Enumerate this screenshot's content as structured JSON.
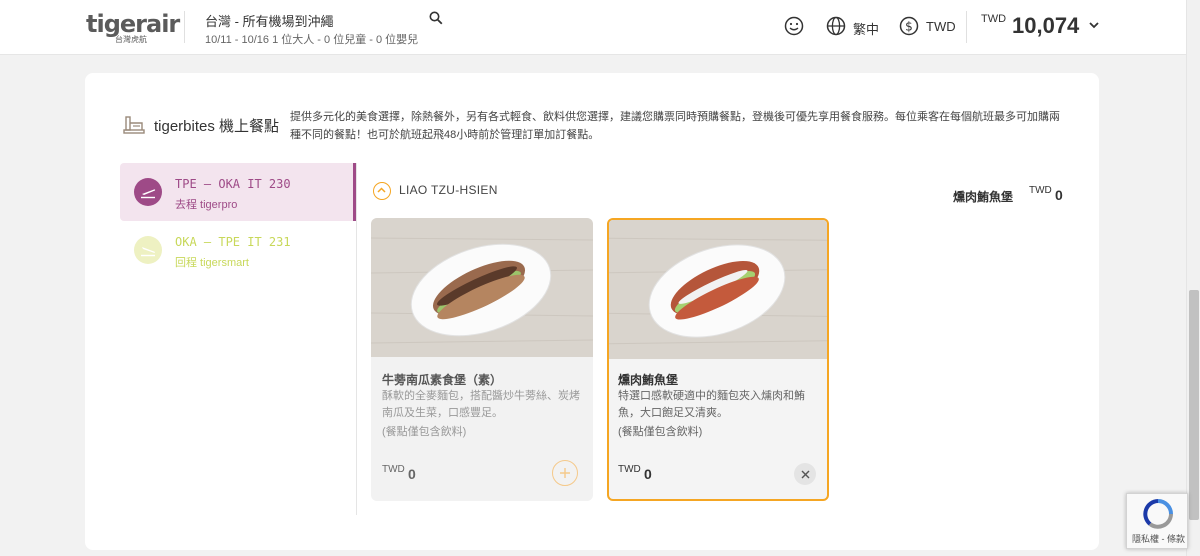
{
  "header": {
    "logo_text": "tigerair",
    "logo_sub": "台灣虎航",
    "route": "台灣 - 所有機場到沖繩",
    "trip_details": "10/11 - 10/16  1 位大人 - 0 位兒童 - 0 位嬰兒",
    "language": "繁中",
    "currency": "TWD",
    "total_currency": "TWD",
    "total_amount": "10,074"
  },
  "section": {
    "title": "tigerbites 機上餐點",
    "description": "提供多元化的美食選擇，除熱餐外，另有各式輕食、飲料供您選擇，建議您購票同時預購餐點，登機後可優先享用餐食服務。每位乘客在每個航班最多可加購兩種不同的餐點！也可於航班起飛48小時前於管理訂單加訂餐點。"
  },
  "flights": [
    {
      "code": "TPE – OKA IT 230",
      "fare": "去程 tigerpro",
      "active": true
    },
    {
      "code": "OKA – TPE IT 231",
      "fare": "回程 tigersmart",
      "active": false
    }
  ],
  "passenger": {
    "name": "LIAO TZU-HSIEN",
    "selected_meal": "燻肉鮪魚堡",
    "selected_currency": "TWD",
    "selected_amount": "0"
  },
  "meals": [
    {
      "title": "牛蒡南瓜素食堡（素）",
      "description": "酥軟的全麥麵包，搭配醬炒牛蒡絲、炭烤南瓜及生菜，口感豐足。",
      "note": "(餐點僅包含飲料)",
      "currency": "TWD",
      "price": "0",
      "selected": false
    },
    {
      "title": "燻肉鮪魚堡",
      "description": "特選口感軟硬適中的麵包夾入燻肉和鮪魚，大口飽足又清爽。",
      "note": "(餐點僅包含飲料)",
      "currency": "TWD",
      "price": "0",
      "selected": true
    }
  ],
  "recaptcha": {
    "text": "隱私權 - 條款"
  },
  "colors": {
    "accent": "#f5a623",
    "active_flight": "#9e4a87",
    "inactive_flight": "#c8d85a"
  }
}
